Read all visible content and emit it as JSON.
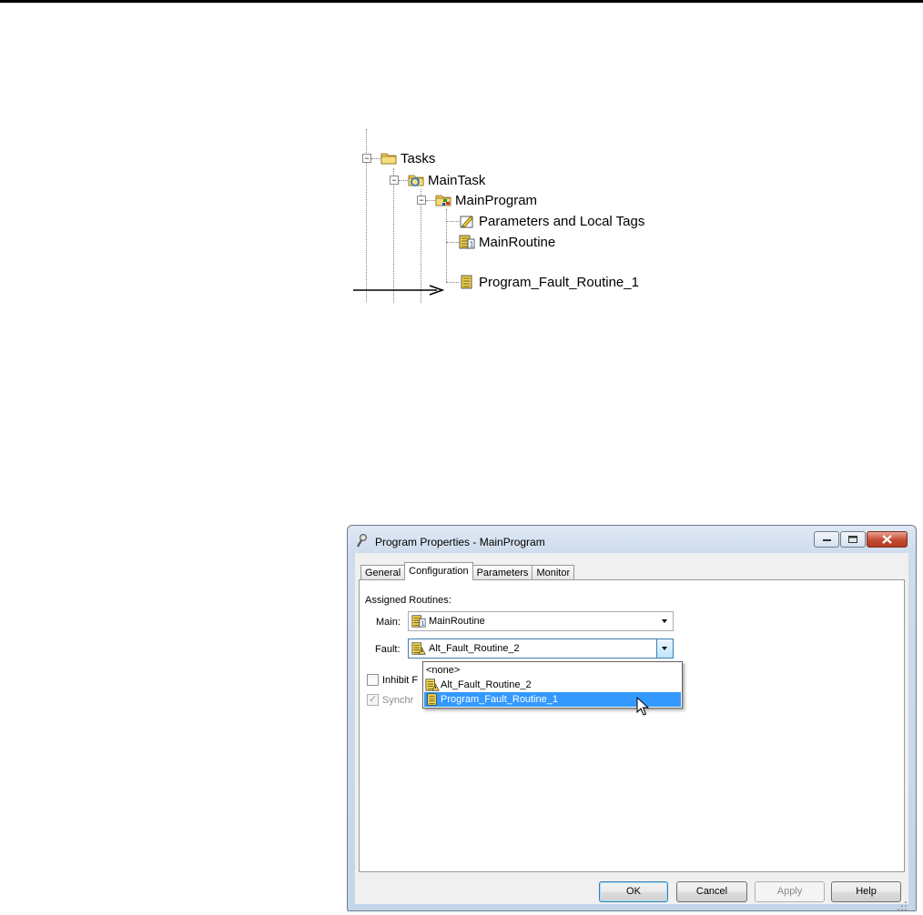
{
  "tree": {
    "nodes": [
      {
        "label": "Tasks",
        "icon": "folder-icon"
      },
      {
        "label": "MainTask",
        "icon": "continuous-task-icon"
      },
      {
        "label": "MainProgram",
        "icon": "program-icon"
      },
      {
        "label": "Parameters and Local Tags",
        "icon": "tags-icon"
      },
      {
        "label": "MainRoutine",
        "icon": "main-routine-icon"
      },
      {
        "label": "Program_Fault_Routine_1",
        "icon": "routine-icon"
      }
    ]
  },
  "dialog": {
    "title": "Program Properties - MainProgram",
    "tabs": [
      "General",
      "Configuration",
      "Parameters",
      "Monitor"
    ],
    "active_tab": "Configuration",
    "assigned_routines_label": "Assigned Routines:",
    "main_label": "Main:",
    "main_value": "MainRoutine",
    "fault_label": "Fault:",
    "fault_value": "Alt_Fault_Routine_2",
    "dropdown_options": [
      "<none>",
      "Alt_Fault_Routine_2",
      "Program_Fault_Routine_1"
    ],
    "selected_option": "Program_Fault_Routine_1",
    "inhibit_label": "Inhibit F",
    "inhibit_checked": false,
    "synchronize_label": "Synchr",
    "synchronize_checked": true,
    "buttons": {
      "ok": "OK",
      "cancel": "Cancel",
      "apply": "Apply",
      "help": "Help"
    }
  },
  "colors": {
    "selection": "#3399ff",
    "title_gradient": "#cfdcec",
    "close_button": "#c44a32"
  }
}
